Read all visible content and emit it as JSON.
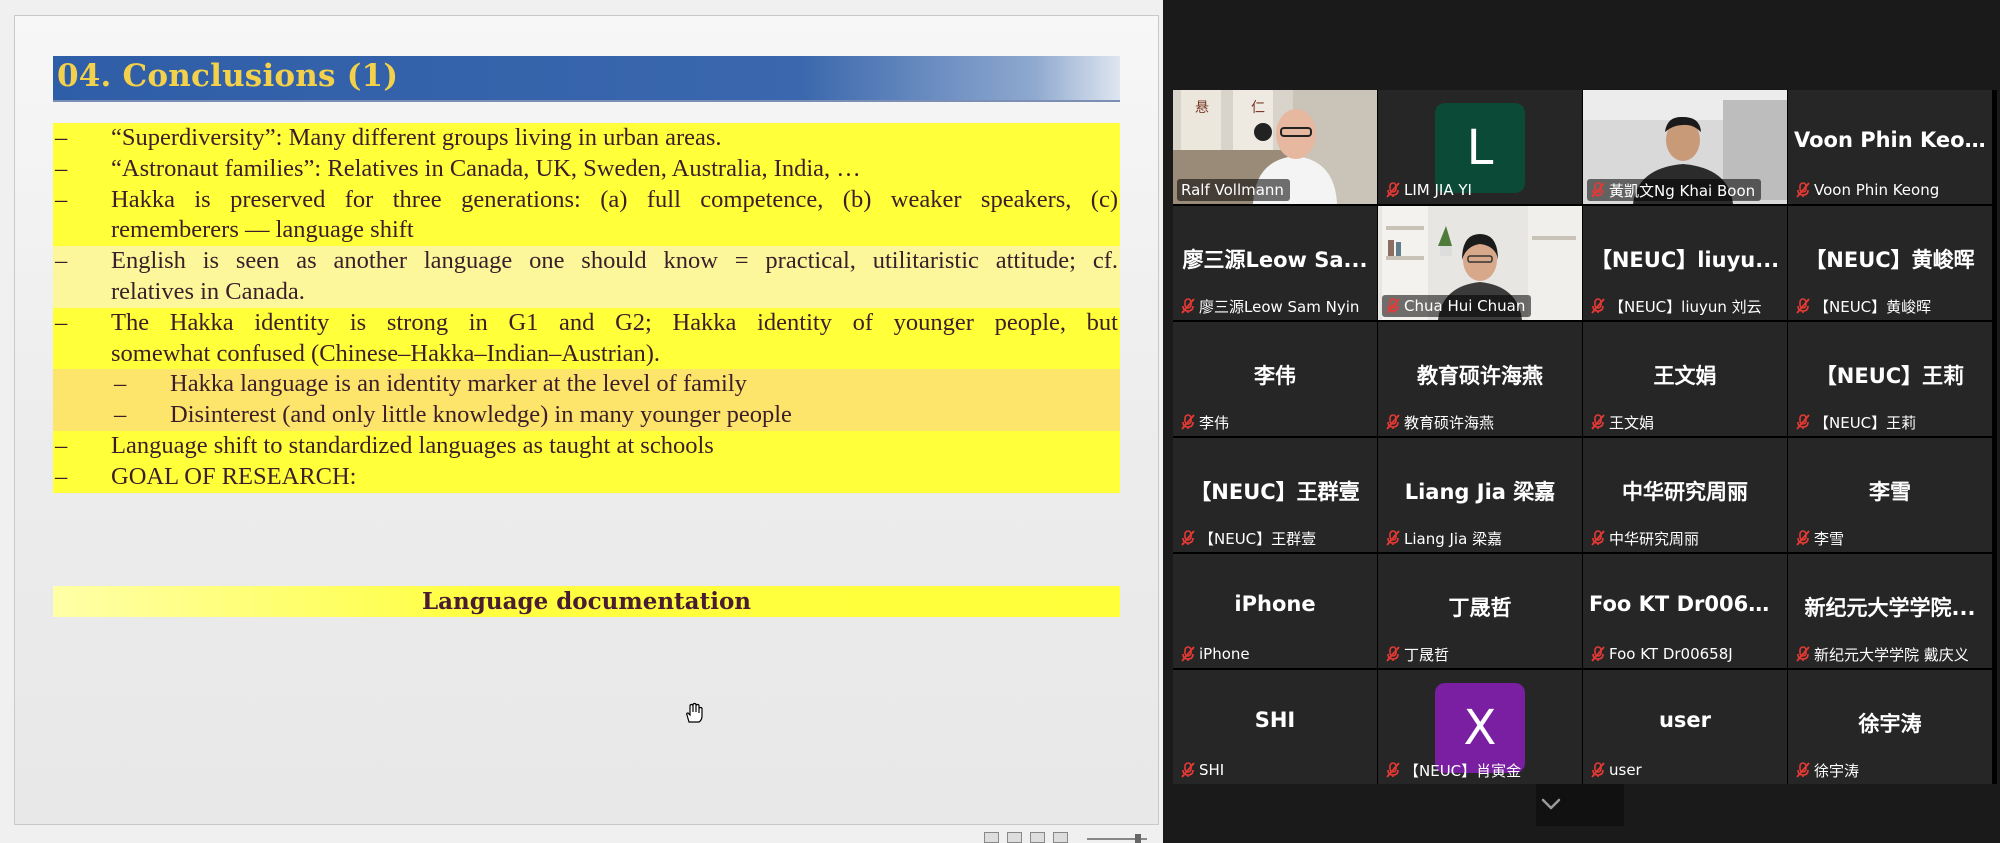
{
  "slide": {
    "title": "04. Conclusions (1)",
    "bullets": [
      {
        "dash": "–",
        "text": "“Superdiversity”: Many different groups living in urban areas."
      },
      {
        "dash": "–",
        "text": "“Astronaut families”: Relatives in Canada, UK, Sweden, Australia, India, …"
      },
      {
        "dash": "–",
        "text": "Hakka is preserved for three generations: (a) full competence, (b) weaker speakers, (c)"
      },
      {
        "dash": "",
        "text": "rememberers –– language shift"
      },
      {
        "dash": "–",
        "text": "English is seen as another language one should know = practical, utilitaristic attitude; cf."
      },
      {
        "dash": "",
        "text": "relatives in Canada."
      },
      {
        "dash": "–",
        "text": "The Hakka identity is strong in G1 and G2; Hakka identity of younger people, but"
      },
      {
        "dash": "",
        "text": "somewhat confused (Chinese–Hakka–Indian–Austrian)."
      },
      {
        "dash": "–",
        "text": "Hakka language is an identity marker at the level of family"
      },
      {
        "dash": "–",
        "text": "Disinterest (and only little knowledge) in many younger people"
      },
      {
        "dash": "–",
        "text": "Language shift to standardized languages as taught at schools"
      },
      {
        "dash": "–",
        "text": "GOAL OF RESEARCH:"
      }
    ],
    "highlight_box": "Language documentation",
    "colors": {
      "title_text": "#f3d14a",
      "title_bar": "#2f5ea8",
      "highlight": "#ffff3a",
      "body_text": "#3b1e2a"
    }
  },
  "participants": [
    {
      "name": "Ralf Vollmann",
      "kind": "video",
      "active_speaker": true
    },
    {
      "name": "LIM JIA YI",
      "kind": "avatar",
      "avatar_letter": "L",
      "avatar_color": "#0c4a38",
      "muted": true
    },
    {
      "name": "黃凱文Ng Khai Boon",
      "kind": "video",
      "muted": true
    },
    {
      "name": "Voon Phin Keong",
      "display": "Voon Phin Keong",
      "kind": "name",
      "muted": true
    },
    {
      "name": "廖三源Leow Sam Nyin",
      "display": "廖三源Leow Sa...",
      "kind": "name",
      "muted": true
    },
    {
      "name": "Chua Hui Chuan",
      "kind": "video",
      "muted": true
    },
    {
      "name": "【NEUC】liuyun 刘云",
      "display": "【NEUC】liuyu...",
      "kind": "name",
      "muted": true
    },
    {
      "name": "【NEUC】黄峻晖",
      "display": "【NEUC】黄峻晖",
      "kind": "name",
      "muted": true
    },
    {
      "name": "李伟",
      "display": "李伟",
      "kind": "name",
      "muted": true
    },
    {
      "name": "教育硕许海燕",
      "display": "教育硕许海燕",
      "kind": "name",
      "muted": true
    },
    {
      "name": "王文娟",
      "display": "王文娟",
      "kind": "name",
      "muted": true
    },
    {
      "name": "【NEUC】王莉",
      "display": "【NEUC】王莉",
      "kind": "name",
      "muted": true
    },
    {
      "name": "【NEUC】王群壹",
      "display": "【NEUC】王群壹",
      "kind": "name",
      "muted": true
    },
    {
      "name": "Liang Jia 梁嘉",
      "display": "Liang Jia 梁嘉",
      "kind": "name",
      "muted": true
    },
    {
      "name": "中华研究周丽",
      "display": "中华研究周丽",
      "kind": "name",
      "muted": true
    },
    {
      "name": "李雪",
      "display": "李雪",
      "kind": "name",
      "muted": true
    },
    {
      "name": "iPhone",
      "display": "iPhone",
      "kind": "name",
      "muted": true
    },
    {
      "name": "丁晟哲",
      "display": "丁晟哲",
      "kind": "name",
      "muted": true
    },
    {
      "name": "Foo KT Dr00658J",
      "display": "Foo KT Dr00658J",
      "kind": "name",
      "muted": true
    },
    {
      "name": "新纪元大学学院 戴庆义",
      "display": "新纪元大学学院...",
      "kind": "name",
      "muted": true
    },
    {
      "name": "SHI",
      "display": "SHI",
      "kind": "name",
      "muted": true
    },
    {
      "name": "【NEUC】肖寅金",
      "kind": "avatar",
      "avatar_letter": "X",
      "avatar_color": "#7a1fa2",
      "muted": true
    },
    {
      "name": "user",
      "display": "user",
      "kind": "name",
      "muted": true
    },
    {
      "name": "徐宇涛",
      "display": "徐宇涛",
      "kind": "name",
      "muted": true
    }
  ],
  "icons": {
    "mute": "mic-muted-icon",
    "collapse": "chevron-down-icon",
    "cursor": "hand-cursor-icon"
  }
}
